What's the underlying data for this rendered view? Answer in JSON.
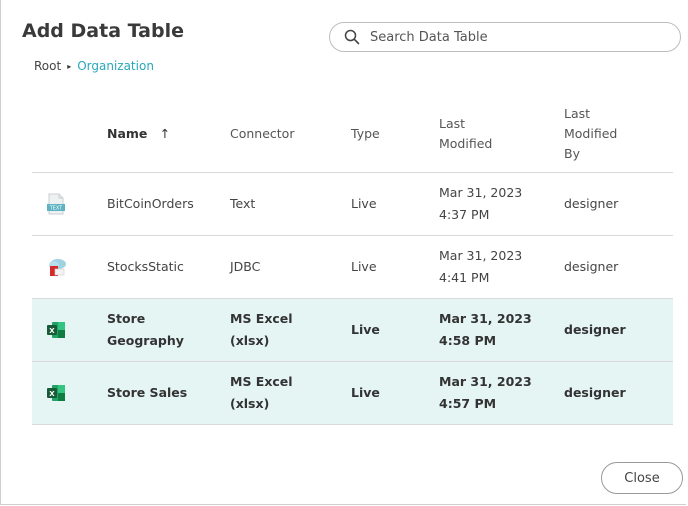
{
  "dialog": {
    "title": "Add Data Table",
    "search": {
      "placeholder": "Search Data Table",
      "value": ""
    },
    "breadcrumb": {
      "root": "Root",
      "separator": "▸",
      "current": "Organization"
    },
    "columns": {
      "name": "Name",
      "sort_indicator": "↑",
      "connector": "Connector",
      "type": "Type",
      "last_modified": "Last Modified",
      "last_modified_by": "Last Modified By"
    },
    "rows": [
      {
        "icon": "text-file-icon",
        "name": "BitCoinOrders",
        "connector": "Text",
        "type": "Live",
        "modified_date": "Mar 31, 2023",
        "modified_time": "4:37 PM",
        "modified_by": "designer",
        "selected": false
      },
      {
        "icon": "jdbc-icon",
        "name": "StocksStatic",
        "connector": "JDBC",
        "type": "Live",
        "modified_date": "Mar 31, 2023",
        "modified_time": "4:41 PM",
        "modified_by": "designer",
        "selected": false
      },
      {
        "icon": "excel-icon",
        "name": "Store Geography",
        "connector": "MS Excel (xlsx)",
        "type": "Live",
        "modified_date": "Mar 31, 2023",
        "modified_time": "4:58 PM",
        "modified_by": "designer",
        "selected": true
      },
      {
        "icon": "excel-icon",
        "name": "Store Sales",
        "connector": "MS Excel (xlsx)",
        "type": "Live",
        "modified_date": "Mar 31, 2023",
        "modified_time": "4:57 PM",
        "modified_by": "designer",
        "selected": true
      }
    ],
    "close_label": "Close",
    "colors": {
      "accent": "#2aa7b8",
      "selected_row": "#e4f5f4",
      "excel_green": "#1f7a44"
    }
  }
}
